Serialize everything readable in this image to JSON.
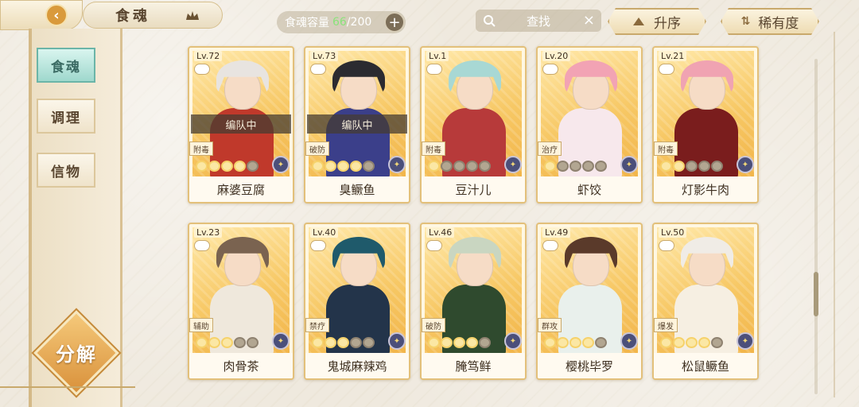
{
  "header": {
    "title": "食魂",
    "capacity_label": "食魂容量",
    "capacity_current": "66",
    "capacity_max": "/200",
    "search_placeholder": "查找",
    "sort_asc_label": "升序",
    "sort_rarity_label": "稀有度"
  },
  "sidebar": {
    "items": [
      {
        "label": "食魂",
        "active": true
      },
      {
        "label": "调理",
        "active": false
      },
      {
        "label": "信物",
        "active": false
      }
    ],
    "decompose_label": "分解"
  },
  "cards": [
    {
      "level": "Lv.72",
      "name": "麻婆豆腐",
      "role": "附毒",
      "team": "编队中",
      "stars_lit": 4,
      "hair": "#e8e4e0",
      "body": "#c0392b"
    },
    {
      "level": "Lv.73",
      "name": "臭鳜鱼",
      "role": "破防",
      "team": "编队中",
      "stars_lit": 4,
      "hair": "#2b2b30",
      "body": "#3b3f8a"
    },
    {
      "level": "Lv.1",
      "name": "豆汁儿",
      "role": "附毒",
      "team": "",
      "stars_lit": 1,
      "hair": "#a8d8d4",
      "body": "#b73a3a"
    },
    {
      "level": "Lv.20",
      "name": "虾饺",
      "role": "治疗",
      "team": "",
      "stars_lit": 1,
      "hair": "#f2a3b4",
      "body": "#f7e8ec"
    },
    {
      "level": "Lv.21",
      "name": "灯影牛肉",
      "role": "附毒",
      "team": "",
      "stars_lit": 2,
      "hair": "#f0a3b2",
      "body": "#7a1d1d"
    },
    {
      "level": "Lv.23",
      "name": "肉骨茶",
      "role": "辅助",
      "team": "",
      "stars_lit": 3,
      "hair": "#7a6350",
      "body": "#efe8dc"
    },
    {
      "level": "Lv.40",
      "name": "鬼城麻辣鸡",
      "role": "禁疗",
      "team": "",
      "stars_lit": 3,
      "hair": "#1f5a6b",
      "body": "#23344a"
    },
    {
      "level": "Lv.46",
      "name": "腌笃鲜",
      "role": "破防",
      "team": "",
      "stars_lit": 4,
      "hair": "#c9d6c1",
      "body": "#2f4a2e"
    },
    {
      "level": "Lv.49",
      "name": "樱桃毕罗",
      "role": "群攻",
      "team": "",
      "stars_lit": 4,
      "hair": "#5a3a2a",
      "body": "#e9f0ec"
    },
    {
      "level": "Lv.50",
      "name": "松鼠鳜鱼",
      "role": "爆发",
      "team": "",
      "stars_lit": 4,
      "hair": "#f0ece6",
      "body": "#f6efe2"
    }
  ]
}
